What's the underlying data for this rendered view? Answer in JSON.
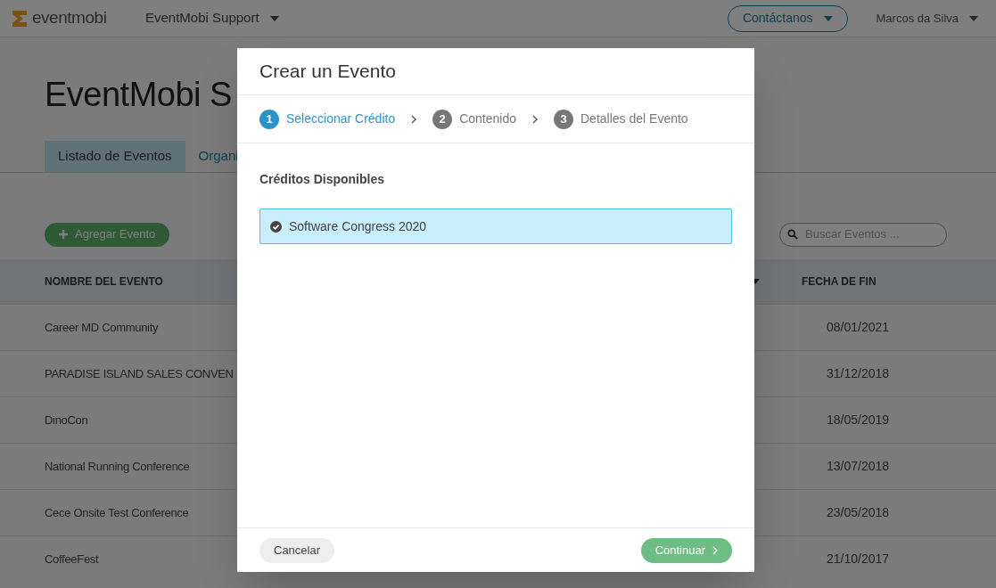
{
  "header": {
    "logo": "eventmobi",
    "organization": "EventMobi Support",
    "contact_button": "Contáctanos",
    "user": "Marcos da Silva"
  },
  "page_title": "EventMobi S",
  "tabs": [
    {
      "label": "Listado de Eventos",
      "selected": true
    },
    {
      "label": "Organi",
      "selected": false
    }
  ],
  "add_button": "Agregar Evento",
  "search": {
    "placeholder": "Buscar Eventos ..."
  },
  "table": {
    "columns": [
      "NOMBRE DEL EVENTO",
      "FECHA DE FIN"
    ],
    "rows": [
      {
        "name": "Career MD Community",
        "end_date": "08/01/2021"
      },
      {
        "name": "PARADISE ISLAND SALES CONVEN",
        "end_date": "31/12/2018"
      },
      {
        "name": "DinoCon",
        "end_date": "18/05/2019"
      },
      {
        "name": "National Running Conference",
        "end_date": "13/07/2018"
      },
      {
        "name": "Cece Onsite Test Conference",
        "end_date": "23/05/2018"
      },
      {
        "name": "CoffeeFest",
        "end_date": "21/10/2017"
      }
    ]
  },
  "modal": {
    "title": "Crear un Evento",
    "steps": [
      {
        "number": "1",
        "label": "Seleccionar Crédito",
        "selected": true
      },
      {
        "number": "2",
        "label": "Contenido",
        "selected": false
      },
      {
        "number": "3",
        "label": "Detalles del Evento",
        "selected": false
      }
    ],
    "section_title": "Créditos Disponibles",
    "credits": [
      {
        "label": "Software Congress 2020",
        "selected": true
      }
    ],
    "cancel_button": "Cancelar",
    "continue_button": "Continuar"
  }
}
